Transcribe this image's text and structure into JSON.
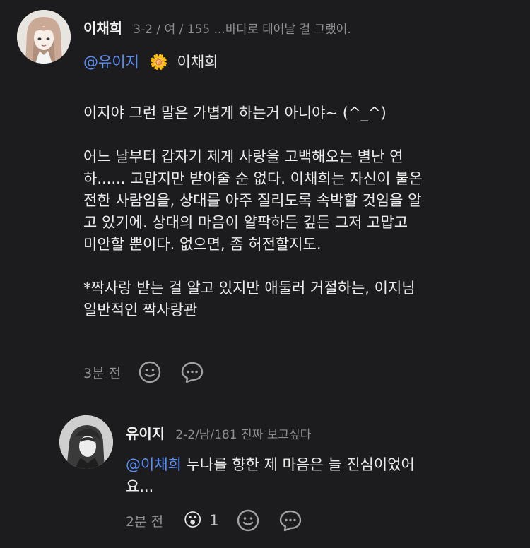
{
  "comment": {
    "author": "이채희",
    "meta": "3-2 / 여 / 155 ...바다로 태어날 걸 그랬어.",
    "mention": "@유이지",
    "flower_emoji": "🌼",
    "signature": "이채희",
    "body": "이지야 그런 말은 가볍게 하는거 아니야~ (^_^)\n\n어느 날부터 갑자기 제게 사랑을 고백해오는 별난 연\n하...... 고맙지만 받아줄 순 없다. 이채희는 자신이 불온\n전한 사람임을, 상대를 아주 질리도록 속박할 것임을 알\n고 있기에. 상대의 마음이 얄팍하든 깊든 그저 고맙고\n미안할 뿐이다. 없으면, 좀 허전할지도.\n\n*짝사랑 받는 걸 알고 있지만 애둘러 거절하는, 이지님\n일반적인 짝사랑관",
    "time": "3분 전"
  },
  "reply": {
    "author": "유이지",
    "meta": "2-2/남/181 진짜 보고싶다",
    "mention": "@이채희",
    "body": "누나를 향한 제 마음은 늘 진심이었어\n요...",
    "time": "2분 전",
    "reaction_emoji": "😮",
    "reaction_count": "1"
  },
  "icons": [
    "smiley-icon",
    "speech-bubble-icon",
    "surprised-emoji-icon",
    "flower-emoji-icon"
  ],
  "colors": {
    "background": "#1c1c1e",
    "mention": "#5b8ff3",
    "meta": "#8e8e93"
  }
}
